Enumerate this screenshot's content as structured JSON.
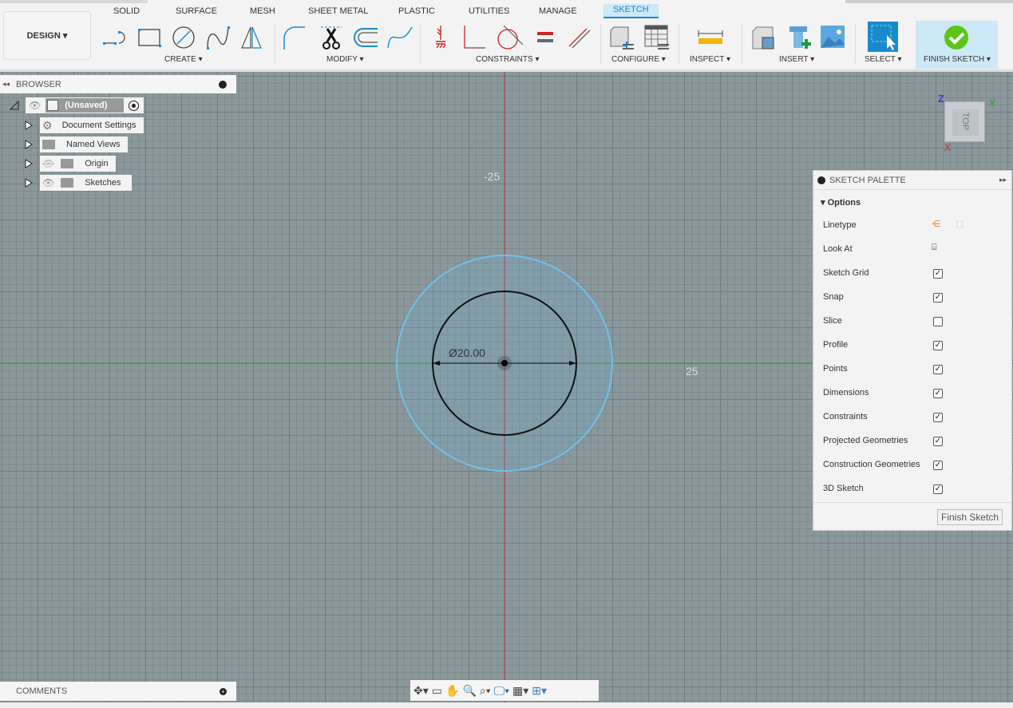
{
  "toolbar": {
    "workspace": "DESIGN",
    "tabs": [
      "SOLID",
      "SURFACE",
      "MESH",
      "SHEET METAL",
      "PLASTIC",
      "UTILITIES",
      "MANAGE",
      "SKETCH"
    ],
    "active_tab": "SKETCH",
    "groups": {
      "create": "CREATE ▾",
      "modify": "MODIFY ▾",
      "constraints": "CONSTRAINTS ▾",
      "configure": "CONFIGURE ▾",
      "inspect": "INSPECT ▾",
      "insert": "INSERT ▾",
      "select": "SELECT ▾",
      "finish": "FINISH SKETCH ▾"
    }
  },
  "browser": {
    "title": "BROWSER",
    "root": "(Unsaved)",
    "items": [
      "Document Settings",
      "Named Views",
      "Origin",
      "Sketches"
    ]
  },
  "canvas": {
    "dimension": "Ø20.00",
    "axis_label_top": "-25",
    "axis_label_right": "25",
    "viewcube": "TOP",
    "axes": {
      "x": "X",
      "y": "Y",
      "z": "Z"
    }
  },
  "palette": {
    "title": "SKETCH PALETTE",
    "section": "Options",
    "rows": [
      {
        "label": "Linetype",
        "type": "icons"
      },
      {
        "label": "Look At",
        "type": "icon"
      },
      {
        "label": "Sketch Grid",
        "checked": true
      },
      {
        "label": "Snap",
        "checked": true
      },
      {
        "label": "Slice",
        "checked": false
      },
      {
        "label": "Profile",
        "checked": true
      },
      {
        "label": "Points",
        "checked": true
      },
      {
        "label": "Dimensions",
        "checked": true
      },
      {
        "label": "Constraints",
        "checked": true
      },
      {
        "label": "Projected Geometries",
        "checked": true
      },
      {
        "label": "Construction Geometries",
        "checked": true
      },
      {
        "label": "3D Sketch",
        "checked": true
      }
    ],
    "finish": "Finish Sketch"
  },
  "comments": {
    "title": "COMMENTS"
  },
  "colors": {
    "accent": "#1a8ad0",
    "finish_green": "#5cc51a",
    "profile_blue": "#6ec3ec",
    "x_axis": "#c83232",
    "y_axis": "#2a9a2a"
  }
}
